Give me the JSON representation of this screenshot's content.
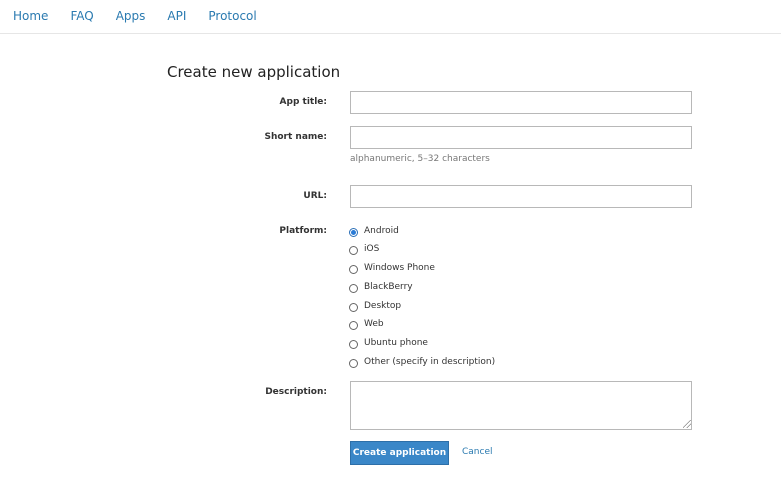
{
  "nav": {
    "items": [
      "Home",
      "FAQ",
      "Apps",
      "API",
      "Protocol"
    ]
  },
  "form": {
    "title": "Create new application",
    "app_title_label": "App title:",
    "app_title_value": "",
    "short_name_label": "Short name:",
    "short_name_value": "",
    "short_name_hint": "alphanumeric, 5–32 characters",
    "url_label": "URL:",
    "url_value": "",
    "platform_label": "Platform:",
    "platforms": [
      "Android",
      "iOS",
      "Windows Phone",
      "BlackBerry",
      "Desktop",
      "Web",
      "Ubuntu phone",
      "Other (specify in description)"
    ],
    "selected_platform": "Android",
    "description_label": "Description:",
    "description_value": "",
    "submit_label": "Create application",
    "cancel_label": "Cancel"
  },
  "colors": {
    "link": "#2a7ab0",
    "primary_button": "#3a87c8"
  }
}
